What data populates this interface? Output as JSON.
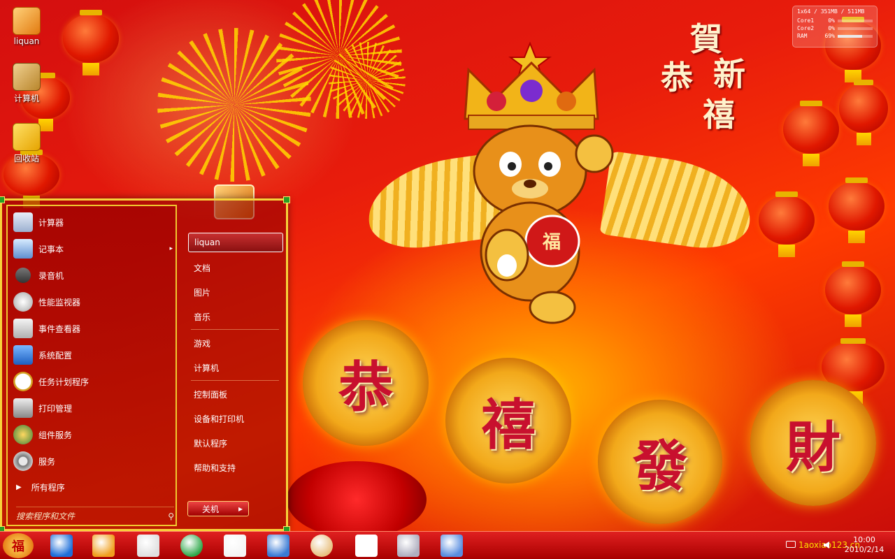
{
  "desktop": {
    "icons": [
      {
        "label": "liquan",
        "icon": "user-folder-icon"
      },
      {
        "label": "计算机",
        "icon": "computer-icon"
      },
      {
        "label": "回收站",
        "icon": "recycle-bin-icon"
      }
    ]
  },
  "wallpaper": {
    "coins": [
      "恭",
      "禧",
      "發",
      "財"
    ],
    "calligraphy": [
      "賀",
      "恭",
      "新",
      "禧"
    ],
    "badge_char": "福"
  },
  "gadget": {
    "header": "1x64 / 351MB / 511MB",
    "rows": [
      {
        "label": "Core1",
        "value": "0%",
        "level": 0
      },
      {
        "label": "Core2",
        "value": "0%",
        "level": 0
      },
      {
        "label": "RAM",
        "value": "69%",
        "level": 69
      }
    ]
  },
  "start_menu": {
    "programs": [
      {
        "label": "计算器",
        "icon": "calculator-icon",
        "has_submenu": false
      },
      {
        "label": "记事本",
        "icon": "notepad-icon",
        "has_submenu": true
      },
      {
        "label": "录音机",
        "icon": "microphone-icon",
        "has_submenu": false
      },
      {
        "label": "性能监视器",
        "icon": "performance-monitor-icon",
        "has_submenu": false
      },
      {
        "label": "事件查看器",
        "icon": "event-viewer-icon",
        "has_submenu": false
      },
      {
        "label": "系统配置",
        "icon": "system-config-icon",
        "has_submenu": false
      },
      {
        "label": "任务计划程序",
        "icon": "clock-icon",
        "has_submenu": false
      },
      {
        "label": "打印管理",
        "icon": "printer-icon",
        "has_submenu": false
      },
      {
        "label": "组件服务",
        "icon": "component-services-icon",
        "has_submenu": false
      },
      {
        "label": "服务",
        "icon": "gears-icon",
        "has_submenu": false
      }
    ],
    "submenu_arrow": "▸",
    "all_programs": "所有程序",
    "all_programs_arrow": "▶",
    "search_placeholder": "搜索程序和文件",
    "search_icon_glyph": "⚲",
    "right_items": [
      {
        "label": "liquan",
        "selected": true
      },
      {
        "label": "文档"
      },
      {
        "label": "图片"
      },
      {
        "label": "音乐"
      },
      {
        "label": "游戏"
      },
      {
        "label": "计算机"
      },
      {
        "label": "控制面板"
      },
      {
        "label": "设备和打印机"
      },
      {
        "label": "默认程序"
      },
      {
        "label": "帮助和支持"
      }
    ],
    "shutdown_label": "关机",
    "shutdown_arrow": "▸"
  },
  "taskbar": {
    "start_glyph": "福",
    "pinned": [
      {
        "name": "internet-explorer-icon",
        "color": "#1e6fd9"
      },
      {
        "name": "media-player-icon",
        "color": "#f0a020"
      },
      {
        "name": "paint-brush-icon",
        "color": "#e0e0e0"
      },
      {
        "name": "refresh-green-icon",
        "color": "#2ea84a"
      },
      {
        "name": "chart-notepad-icon",
        "color": "#f4f4f4"
      },
      {
        "name": "remote-desktop-icon",
        "color": "#3a7bd5"
      },
      {
        "name": "paint-palette-icon",
        "color": "#e8c080"
      },
      {
        "name": "wordpad-icon",
        "color": "#ffffff"
      },
      {
        "name": "picture-icon",
        "color": "#b0b0c0"
      },
      {
        "name": "window-icon",
        "color": "#5a8ee0"
      }
    ],
    "tray": {
      "watermark": "1aoxiao123.cn",
      "time": "10:00",
      "date": "2010/2/14"
    }
  }
}
